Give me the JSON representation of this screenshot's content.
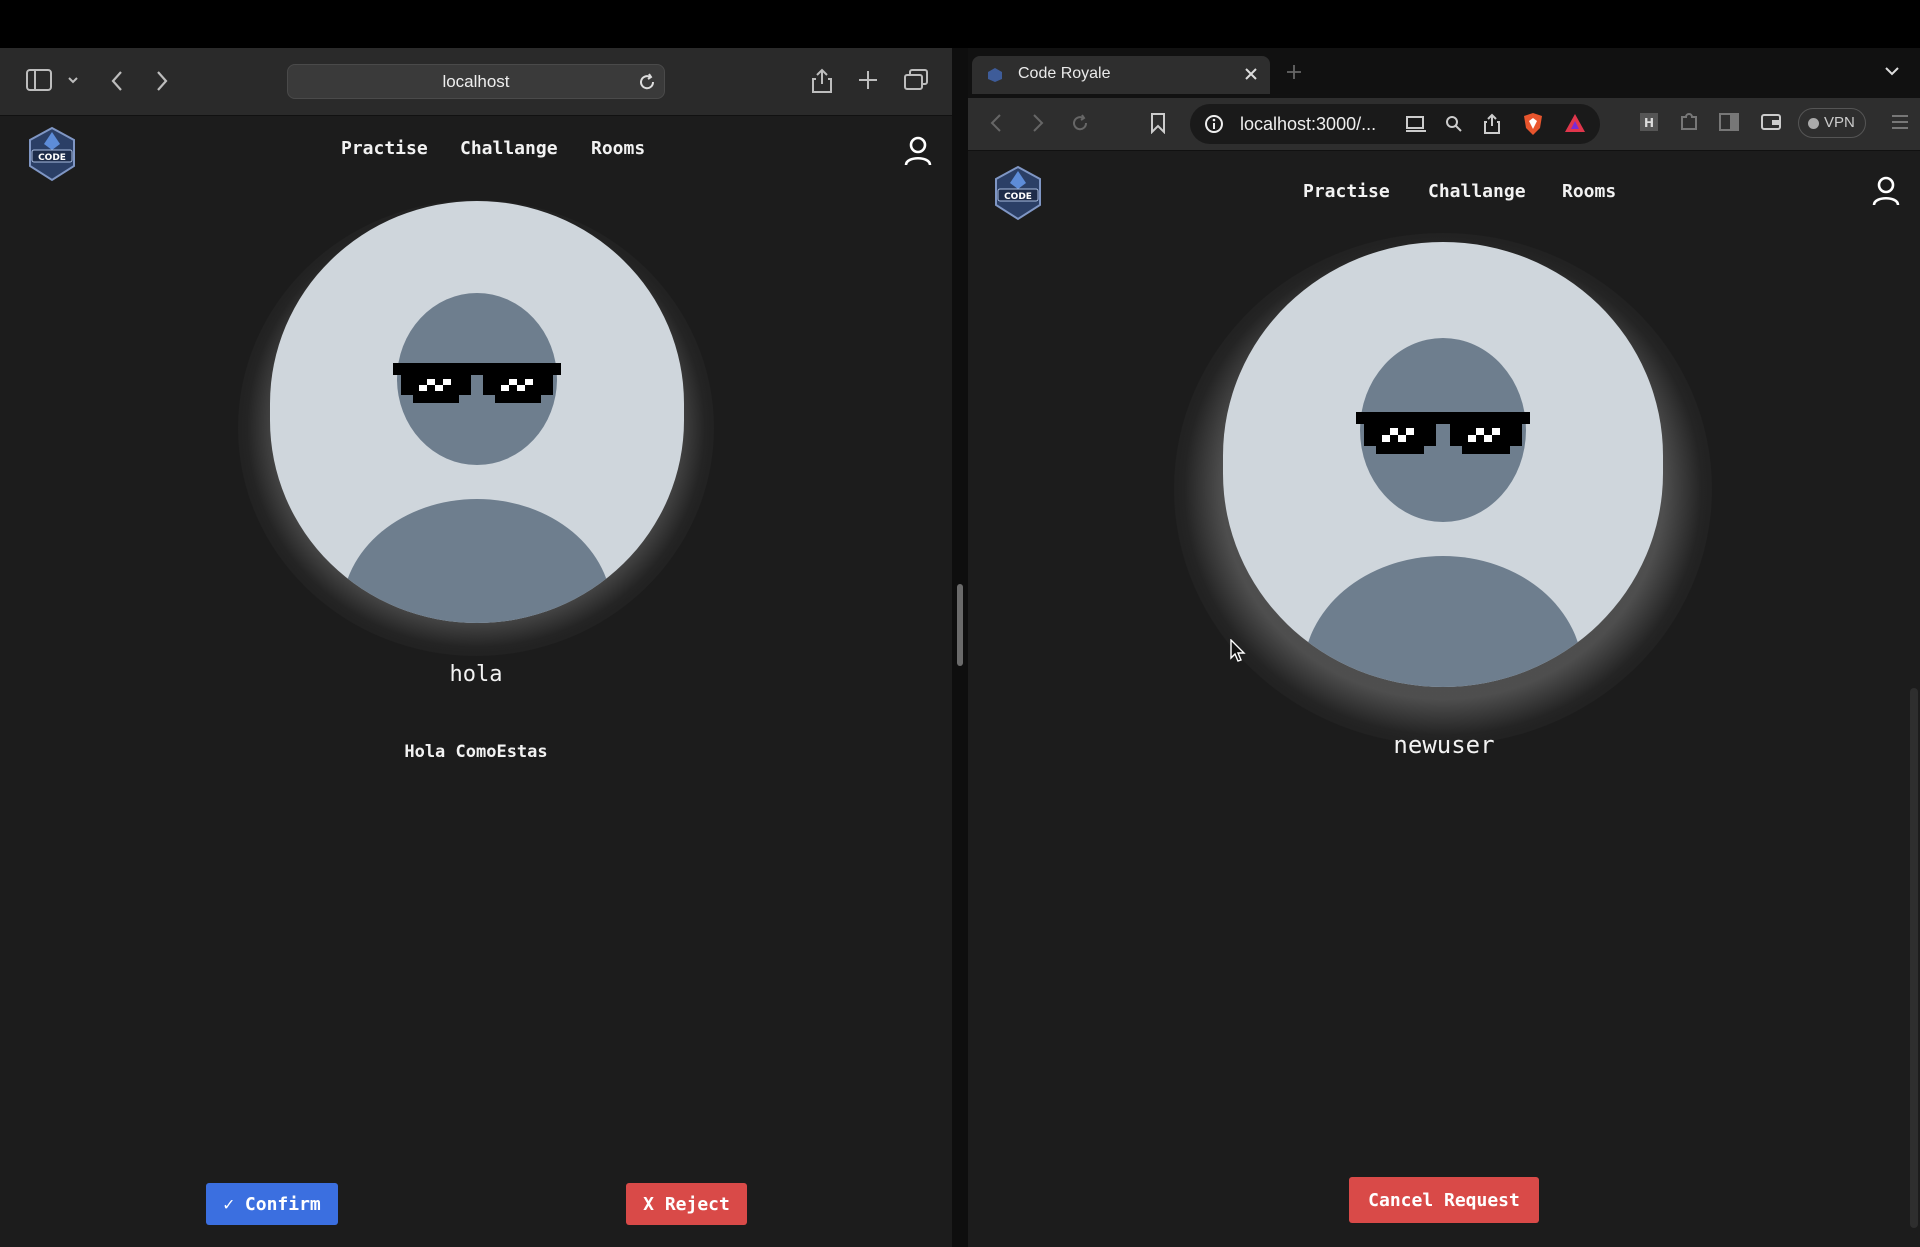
{
  "left_window": {
    "address_bar": {
      "url": "localhost"
    },
    "nav": {
      "practise": "Practise",
      "challange": "Challange",
      "rooms": "Rooms"
    },
    "profile": {
      "username": "hola",
      "bio": "Hola ComoEstas"
    },
    "actions": {
      "confirm_label": "✓ Confirm",
      "reject_label": "X Reject"
    }
  },
  "right_window": {
    "tab": {
      "title": "Code Royale"
    },
    "address_bar": {
      "url": "localhost:3000/..."
    },
    "vpn_label": "VPN",
    "nav": {
      "practise": "Practise",
      "challange": "Challange",
      "rooms": "Rooms"
    },
    "profile": {
      "username": "newuser"
    },
    "actions": {
      "cancel_label": "Cancel Request"
    }
  },
  "logo_text": "CODE",
  "colors": {
    "page_bg": "#1c1c1c",
    "confirm": "#3b6fe0",
    "reject": "#d94a48",
    "avatar_bg": "#cfd6dc",
    "avatar_figure": "#6e7e8e"
  }
}
